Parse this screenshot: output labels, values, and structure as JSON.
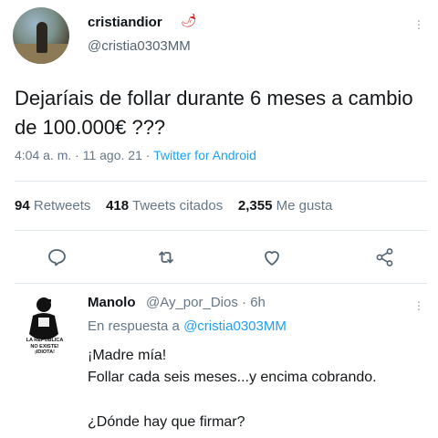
{
  "tweet": {
    "author_name": "cristiandior",
    "author_emoji": "🌶",
    "author_handle": "@cristia0303MM",
    "text": "Dejaríais de follar durante 6 meses a cambio de 100.000€ ???",
    "time": "4:04 a. m.",
    "date": "11 ago. 21",
    "source": "Twitter for Android",
    "sep": "·"
  },
  "stats": {
    "retweets_count": "94",
    "retweets_label": "Retweets",
    "quotes_count": "418",
    "quotes_label": "Tweets citados",
    "likes_count": "2,355",
    "likes_label": "Me gusta"
  },
  "actions": [
    "reply-icon",
    "retweet-icon",
    "like-icon",
    "share-icon"
  ],
  "reply": {
    "author_name": "Manolo",
    "author_handle": "@Ay_por_Dios",
    "sep": "·",
    "age": "6h",
    "in_reply_prefix": "En respuesta a",
    "in_reply_mention": "@cristia0303MM",
    "line1": "¡Madre mía!",
    "line2": "Follar cada seis meses...y encima cobrando.",
    "line3": "¿Dónde hay que firmar?",
    "avatar_text": [
      "LA REPÚBLICA",
      "NO EXISTE!",
      "¡IDIOTA!"
    ]
  },
  "colors": {
    "accent": "#1da1f2",
    "secondary_text": "#657786",
    "divider": "#e1e8ed"
  }
}
